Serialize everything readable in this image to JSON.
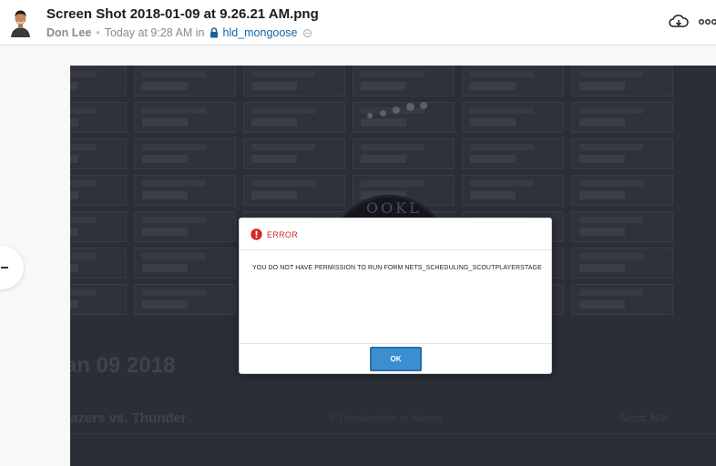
{
  "header": {
    "file_title": "Screen Shot 2018-01-09 at 9.26.21 AM.png",
    "author": "Don Lee",
    "separator": "•",
    "timestamp": "Today at 9:28 AM in",
    "channel": "hld_mongoose",
    "icons": {
      "download": "cloud-download-icon",
      "more": "more-icon",
      "lock": "lock-icon",
      "shared": "shared-channel-icon"
    }
  },
  "preview": {
    "logo_text": "OOKL",
    "date_heading": "an 09 2018",
    "game_title": "lazers vs. Thunder",
    "game_mid": "9 Thunderbirds at Atlanta",
    "game_right": "Scout: N/A"
  },
  "modal": {
    "title": "ERROR",
    "message": "YOU DO NOT HAVE PERMISSION TO RUN FORM NETS_SCHEDULING_SCOUTPLAYERSTAGE",
    "ok_label": "OK"
  },
  "colors": {
    "error_red": "#cc2a2a",
    "ok_blue": "#3b8fd0",
    "link_blue": "#1264a3",
    "overlay_dark": "#2a2e37"
  }
}
